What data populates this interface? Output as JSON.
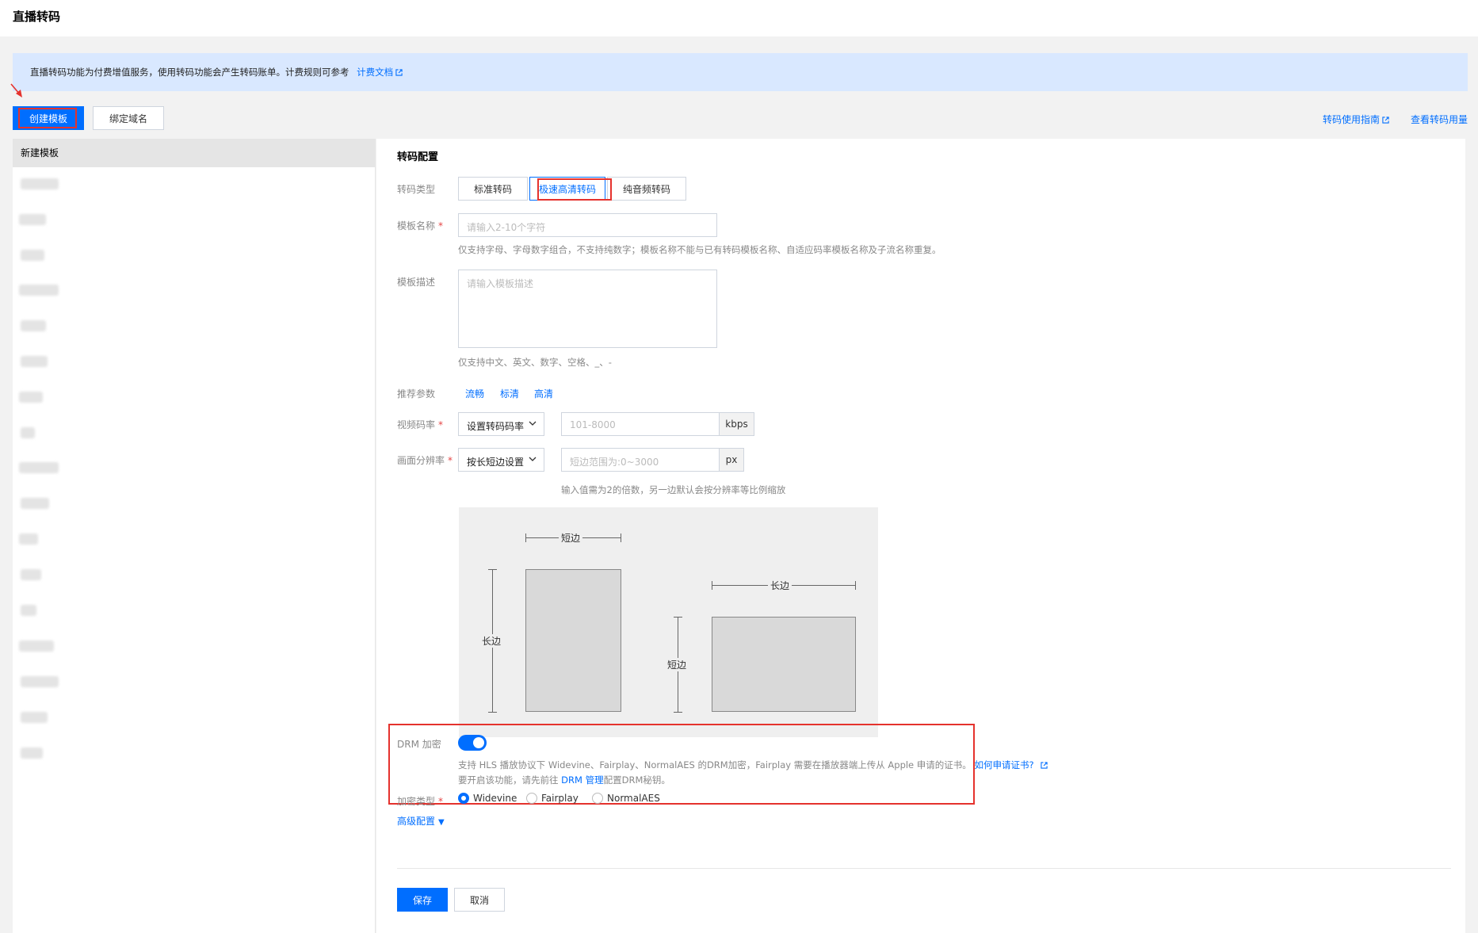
{
  "page": {
    "title": "直播转码"
  },
  "notice": {
    "text": "直播转码功能为付费增值服务，使用转码功能会产生转码账单。计费规则可参考",
    "link": "计费文档"
  },
  "toolbar": {
    "create_label": "创建模板",
    "bind_label": "绑定域名",
    "guide_link": "转码使用指南",
    "usage_link": "查看转码用量"
  },
  "sidebar": {
    "header": "新建模板"
  },
  "form": {
    "section_title": "转码配置",
    "type_label": "转码类型",
    "types": [
      "标准转码",
      "极速高清转码",
      "纯音频转码"
    ],
    "selected_type": "极速高清转码",
    "name_label": "模板名称",
    "name_placeholder": "请输入2-10个字符",
    "name_hint": "仅支持字母、字母数字组合，不支持纯数字；模板名称不能与已有转码模板名称、自适应码率模板名称及子流名称重复。",
    "desc_label": "模板描述",
    "desc_placeholder": "请输入模板描述",
    "desc_hint": "仅支持中文、英文、数字、空格、_、-",
    "recommend_label": "推荐参数",
    "recommend_options": [
      "流畅",
      "标清",
      "高清"
    ],
    "bitrate_label": "视频码率",
    "bitrate_select": "设置转码码率",
    "bitrate_placeholder": "101-8000",
    "bitrate_unit": "kbps",
    "resolution_label": "画面分辨率",
    "resolution_select": "按长短边设置",
    "resolution_placeholder": "短边范围为:0~3000",
    "resolution_unit": "px",
    "resolution_hint": "输入值需为2的倍数，另一边默认会按分辨率等比例缩放",
    "diagram": {
      "short_edge": "短边",
      "long_edge": "长边"
    },
    "drm_label": "DRM 加密",
    "drm_enabled": true,
    "drm_desc_1": "支持 HLS 播放协议下 Widevine、Fairplay、NormalAES 的DRM加密，Fairplay 需要在播放器端上传从 Apple 申请的证书。",
    "drm_cert_link": "如何申请证书?",
    "drm_desc_2_pre": "要开启该功能，请先前往",
    "drm_manage_link": "DRM 管理",
    "drm_desc_2_post": "配置DRM秘钥。",
    "enc_type_label": "加密类型",
    "enc_types": [
      "Widevine",
      "Fairplay",
      "NormalAES"
    ],
    "selected_enc_type": "Widevine",
    "advanced_label": "高级配置",
    "save_label": "保存",
    "cancel_label": "取消"
  },
  "colors": {
    "accent": "#006eff",
    "highlight": "#e5322d",
    "notice_bg": "#d9e8ff"
  }
}
